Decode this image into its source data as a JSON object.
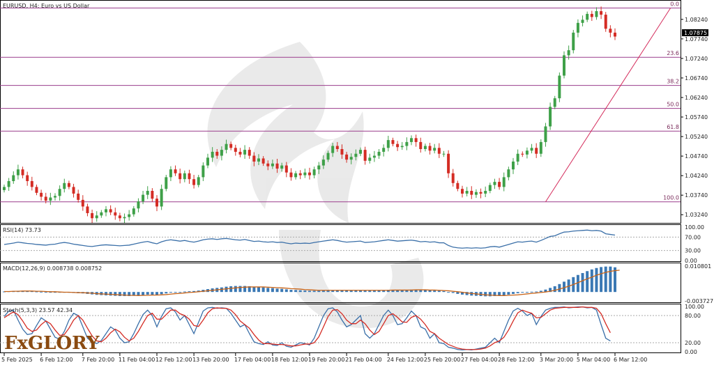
{
  "chart_title": "EURUSD, H4:  Euro vs US Dollar",
  "brand": {
    "logo_text": "FxGLORY",
    "accent": "#7a2a00"
  },
  "colors": {
    "bull": "#3ea048",
    "bear": "#d42c24",
    "fib": "#9a3c8c",
    "rsi": "#3a6fa8",
    "macd_hist": "#3a78b4",
    "signal": "#c86418",
    "stoch_main": "#3a6fa8",
    "stoch_signal": "#d42c24",
    "trend": "#d42c5c"
  },
  "chart_data": [
    {
      "type": "candlestick",
      "series_name": "EURUSD H4",
      "ylim": [
        1.0303,
        1.087
      ],
      "y_ticks": [
        "1.08240",
        "1.07740",
        "1.07240",
        "1.06740",
        "1.06240",
        "1.05740",
        "1.05240",
        "1.04740",
        "1.04240",
        "1.03740",
        "1.03240"
      ],
      "current_price": "1.07875",
      "x_labels": [
        "5 Feb 2025",
        "6 Feb 12:00",
        "7 Feb 20:00",
        "11 Feb 04:00",
        "12 Feb 12:00",
        "13 Feb 20:00",
        "17 Feb 04:00",
        "18 Feb 12:00",
        "19 Feb 20:00",
        "21 Feb 04:00",
        "24 Feb 12:00",
        "25 Feb 20:00",
        "27 Feb 04:00",
        "28 Feb 12:00",
        "3 Mar 20:00",
        "5 Mar 04:00",
        "6 Mar 12:00"
      ],
      "fibonacci": [
        {
          "level": "0.0",
          "price": 1.0853
        },
        {
          "level": "23.6",
          "price": 1.0727
        },
        {
          "level": "38.2",
          "price": 1.0655
        },
        {
          "level": "50.0",
          "price": 1.0596
        },
        {
          "level": "61.8",
          "price": 1.0538
        },
        {
          "level": "100.0",
          "price": 1.0357
        }
      ],
      "trend_line": {
        "from": [
          117,
          1.0357
        ],
        "to": [
          144,
          1.0853
        ]
      },
      "closes": [
        1.0395,
        1.041,
        1.0425,
        1.044,
        1.0425,
        1.041,
        1.0395,
        1.038,
        1.037,
        1.036,
        1.0368,
        1.0372,
        1.039,
        1.0405,
        1.0395,
        1.0378,
        1.0362,
        1.0345,
        1.0328,
        1.0315,
        1.0322,
        1.033,
        1.0338,
        1.033,
        1.0322,
        1.0315,
        1.0318,
        1.0325,
        1.034,
        1.0358,
        1.0375,
        1.0385,
        1.0365,
        1.0345,
        1.039,
        1.042,
        1.044,
        1.043,
        1.0415,
        1.043,
        1.0415,
        1.04,
        1.042,
        1.045,
        1.047,
        1.0485,
        1.0475,
        1.049,
        1.0505,
        1.0495,
        1.0485,
        1.0478,
        1.049,
        1.0475,
        1.046,
        1.0468,
        1.0455,
        1.0448,
        1.0455,
        1.0442,
        1.045,
        1.0432,
        1.042,
        1.043,
        1.0425,
        1.0432,
        1.0425,
        1.044,
        1.045,
        1.0465,
        1.0482,
        1.05,
        1.0492,
        1.0478,
        1.0465,
        1.0472,
        1.048,
        1.049,
        1.0462,
        1.047,
        1.0475,
        1.0485,
        1.0495,
        1.0515,
        1.0505,
        1.0497,
        1.05,
        1.051,
        1.052,
        1.051,
        1.0492,
        1.05,
        1.0488,
        1.0495,
        1.048,
        1.048,
        1.043,
        1.0405,
        1.039,
        1.0378,
        1.0385,
        1.0375,
        1.0382,
        1.0378,
        1.0385,
        1.04,
        1.0408,
        1.0395,
        1.042,
        1.044,
        1.046,
        1.048,
        1.0478,
        1.0488,
        1.0495,
        1.048,
        1.051,
        1.055,
        1.06,
        1.0622,
        1.068,
        1.0732,
        1.0745,
        1.079,
        1.0815,
        1.0823,
        1.0838,
        1.083,
        1.0845,
        1.0836,
        1.08,
        1.079,
        1.078
      ],
      "rsi": {
        "label": "RSI(14) 73.73",
        "levels": [
          "100.00",
          "70.00",
          "30.00",
          "0.00"
        ],
        "values": [
          48,
          50,
          52,
          55,
          53,
          51,
          50,
          48,
          47,
          46,
          48,
          49,
          52,
          54,
          52,
          49,
          47,
          45,
          43,
          42,
          44,
          46,
          47,
          46,
          45,
          44,
          45,
          46,
          49,
          52,
          55,
          57,
          53,
          50,
          56,
          60,
          62,
          60,
          58,
          60,
          57,
          55,
          58,
          62,
          64,
          65,
          63,
          65,
          66,
          64,
          62,
          61,
          63,
          60,
          57,
          58,
          56,
          55,
          56,
          54,
          55,
          52,
          50,
          52,
          51,
          52,
          51,
          54,
          56,
          58,
          60,
          62,
          60,
          57,
          55,
          56,
          57,
          58,
          54,
          55,
          56,
          58,
          60,
          62,
          60,
          58,
          59,
          60,
          61,
          59,
          56,
          57,
          55,
          56,
          53,
          53,
          45,
          40,
          38,
          37,
          38,
          37,
          38,
          37,
          38,
          41,
          42,
          40,
          44,
          48,
          52,
          56,
          55,
          57,
          58,
          55,
          60,
          66,
          72,
          74,
          80,
          85,
          86,
          88,
          89,
          90,
          91,
          89,
          90,
          88,
          80,
          78,
          76
        ]
      },
      "macd": {
        "label": "MACD(12,26,9) 0.008738 0.008752",
        "levels": [
          "0.010801",
          "-0.003727"
        ],
        "hist": [
          0.0002,
          0.0003,
          0.0004,
          0.0005,
          0.0005,
          0.0004,
          0.0003,
          0.0002,
          0.0001,
          0.0,
          -0.0001,
          -0.0002,
          -0.0002,
          -0.0002,
          -0.0003,
          -0.0004,
          -0.0005,
          -0.0006,
          -0.0008,
          -0.001,
          -0.0012,
          -0.0013,
          -0.0014,
          -0.0015,
          -0.0016,
          -0.0017,
          -0.0017,
          -0.0017,
          -0.0016,
          -0.0015,
          -0.0013,
          -0.0011,
          -0.0011,
          -0.0012,
          -0.0009,
          -0.0006,
          -0.0003,
          -0.0001,
          0.0,
          0.0002,
          0.0003,
          0.0004,
          0.0006,
          0.0009,
          0.0012,
          0.0015,
          0.0017,
          0.0019,
          0.0022,
          0.0024,
          0.0025,
          0.0025,
          0.0025,
          0.0024,
          0.0022,
          0.0021,
          0.0019,
          0.0017,
          0.0016,
          0.0014,
          0.0013,
          0.0011,
          0.0009,
          0.0008,
          0.0007,
          0.0006,
          0.0005,
          0.0005,
          0.0005,
          0.0006,
          0.0007,
          0.0008,
          0.0008,
          0.0008,
          0.0007,
          0.0007,
          0.0007,
          0.0007,
          0.0006,
          0.0006,
          0.0006,
          0.0007,
          0.0008,
          0.0009,
          0.0009,
          0.0009,
          0.0009,
          0.0009,
          0.001,
          0.001,
          0.0009,
          0.0008,
          0.0007,
          0.0006,
          0.0005,
          0.0004,
          0.0,
          -0.0004,
          -0.0008,
          -0.0011,
          -0.0013,
          -0.0015,
          -0.0016,
          -0.0017,
          -0.0018,
          -0.0018,
          -0.0017,
          -0.0016,
          -0.0014,
          -0.0011,
          -0.0008,
          -0.0005,
          -0.0003,
          -0.0001,
          0.0001,
          0.0002,
          0.0005,
          0.001,
          0.0017,
          0.0024,
          0.0033,
          0.0043,
          0.0052,
          0.0062,
          0.0071,
          0.0079,
          0.0087,
          0.0094,
          0.01,
          0.0104,
          0.0106,
          0.0106,
          0.0103
        ],
        "signal": [
          0.0002,
          0.0002,
          0.0003,
          0.0003,
          0.0004,
          0.0004,
          0.0004,
          0.0003,
          0.0003,
          0.0002,
          0.0001,
          0.0001,
          0.0,
          -0.0001,
          -0.0001,
          -0.0002,
          -0.0003,
          -0.0003,
          -0.0004,
          -0.0005,
          -0.0007,
          -0.0008,
          -0.0009,
          -0.001,
          -0.0011,
          -0.0012,
          -0.0013,
          -0.0014,
          -0.0014,
          -0.0015,
          -0.0014,
          -0.0014,
          -0.0013,
          -0.0013,
          -0.0012,
          -0.0011,
          -0.0009,
          -0.0007,
          -0.0006,
          -0.0004,
          -0.0002,
          -0.0001,
          0.0001,
          0.0003,
          0.0005,
          0.0007,
          0.0009,
          0.0011,
          0.0013,
          0.0015,
          0.0017,
          0.0019,
          0.002,
          0.0021,
          0.0021,
          0.0021,
          0.0021,
          0.002,
          0.0019,
          0.0018,
          0.0017,
          0.0016,
          0.0014,
          0.0013,
          0.0012,
          0.001,
          0.0009,
          0.0008,
          0.0007,
          0.0007,
          0.0007,
          0.0007,
          0.0007,
          0.0007,
          0.0007,
          0.0007,
          0.0007,
          0.0007,
          0.0007,
          0.0007,
          0.0007,
          0.0007,
          0.0007,
          0.0007,
          0.0008,
          0.0008,
          0.0008,
          0.0008,
          0.0008,
          0.0009,
          0.0009,
          0.0009,
          0.0008,
          0.0008,
          0.0007,
          0.0006,
          0.0005,
          0.0003,
          0.0001,
          -0.0001,
          -0.0004,
          -0.0006,
          -0.0008,
          -0.001,
          -0.0012,
          -0.0013,
          -0.0014,
          -0.0015,
          -0.0015,
          -0.0014,
          -0.0013,
          -0.0012,
          -0.001,
          -0.0008,
          -0.0006,
          -0.0004,
          -0.0002,
          0.0,
          0.0003,
          0.0007,
          0.0012,
          0.0018,
          0.0024,
          0.0031,
          0.0039,
          0.0047,
          0.0055,
          0.0062,
          0.007,
          0.0076,
          0.0082,
          0.0086,
          0.0089,
          0.0091
        ]
      },
      "stoch": {
        "label": "Stoch(5,3,3) 23.57 42.34",
        "levels": [
          "100.00",
          "80.00",
          "20.00",
          "0.00"
        ],
        "main": [
          78,
          90,
          92,
          70,
          50,
          38,
          40,
          58,
          75,
          68,
          50,
          32,
          28,
          45,
          70,
          85,
          80,
          55,
          30,
          22,
          18,
          25,
          40,
          55,
          48,
          30,
          20,
          22,
          40,
          62,
          82,
          92,
          80,
          55,
          78,
          95,
          97,
          88,
          70,
          80,
          60,
          40,
          65,
          90,
          97,
          98,
          96,
          97,
          96,
          85,
          70,
          55,
          60,
          40,
          22,
          18,
          16,
          22,
          15,
          14,
          20,
          12,
          10,
          15,
          20,
          18,
          15,
          30,
          55,
          80,
          95,
          97,
          88,
          70,
          55,
          60,
          70,
          80,
          40,
          30,
          40,
          60,
          80,
          92,
          80,
          60,
          62,
          75,
          90,
          80,
          55,
          50,
          30,
          40,
          20,
          18,
          10,
          8,
          5,
          4,
          5,
          4,
          6,
          8,
          10,
          20,
          30,
          20,
          45,
          70,
          90,
          96,
          90,
          80,
          85,
          60,
          78,
          92,
          96,
          98,
          98,
          99,
          97,
          98,
          99,
          99,
          97,
          98,
          92,
          60,
          30,
          24
        ],
        "signal": [
          75,
          82,
          88,
          82,
          68,
          52,
          45,
          48,
          60,
          68,
          62,
          48,
          36,
          38,
          52,
          70,
          80,
          70,
          52,
          35,
          24,
          22,
          30,
          42,
          50,
          44,
          32,
          24,
          30,
          45,
          63,
          80,
          85,
          72,
          72,
          82,
          92,
          92,
          84,
          80,
          72,
          58,
          56,
          70,
          86,
          95,
          97,
          96,
          96,
          92,
          82,
          68,
          60,
          52,
          38,
          26,
          18,
          18,
          17,
          16,
          16,
          15,
          13,
          13,
          15,
          17,
          17,
          20,
          33,
          55,
          78,
          92,
          93,
          84,
          70,
          62,
          62,
          70,
          62,
          48,
          38,
          45,
          62,
          80,
          84,
          76,
          66,
          65,
          76,
          80,
          72,
          60,
          45,
          40,
          30,
          23,
          16,
          12,
          8,
          6,
          5,
          5,
          5,
          6,
          8,
          13,
          20,
          24,
          32,
          48,
          68,
          86,
          92,
          88,
          85,
          75,
          76,
          84,
          92,
          96,
          97,
          98,
          98,
          98,
          98,
          99,
          98,
          98,
          96,
          84,
          62,
          42
        ]
      }
    }
  ]
}
